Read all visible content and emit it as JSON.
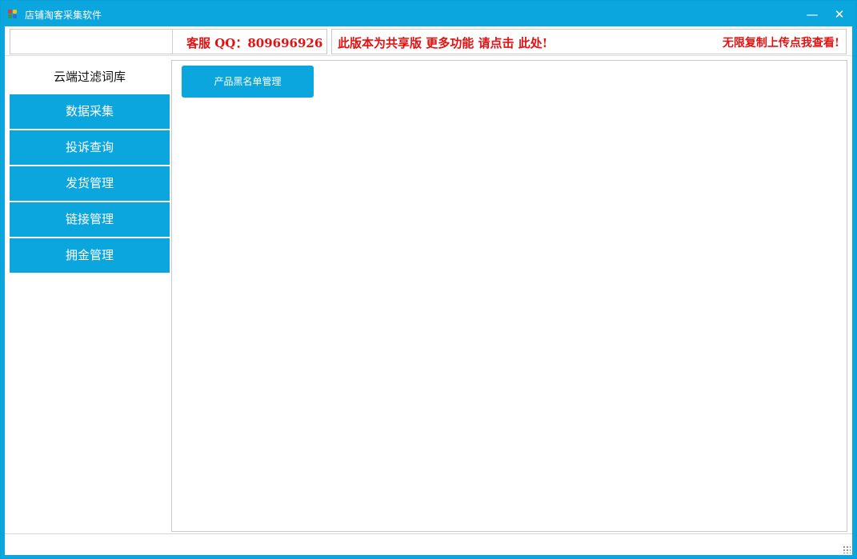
{
  "window": {
    "title": "店铺淘客采集软件",
    "minimize_glyph": "—",
    "close_glyph": "✕",
    "accent_color": "#0ca6df"
  },
  "banner": {
    "contact": "客服 QQ：809696926",
    "promo": "此版本为共享版 更多功能 请点击 此处!",
    "notice": "无限复制上传点我查看!",
    "text_color": "#e31212"
  },
  "sidebar": {
    "header": "云端过滤词库",
    "items": [
      {
        "label": "数据采集"
      },
      {
        "label": "投诉查询"
      },
      {
        "label": "发货管理"
      },
      {
        "label": "链接管理"
      },
      {
        "label": "拥金管理"
      }
    ]
  },
  "main": {
    "blacklist_button": "产品黑名单管理"
  },
  "icons": {
    "app": "app-logo-icon",
    "resize": "resize-grip-icon"
  }
}
